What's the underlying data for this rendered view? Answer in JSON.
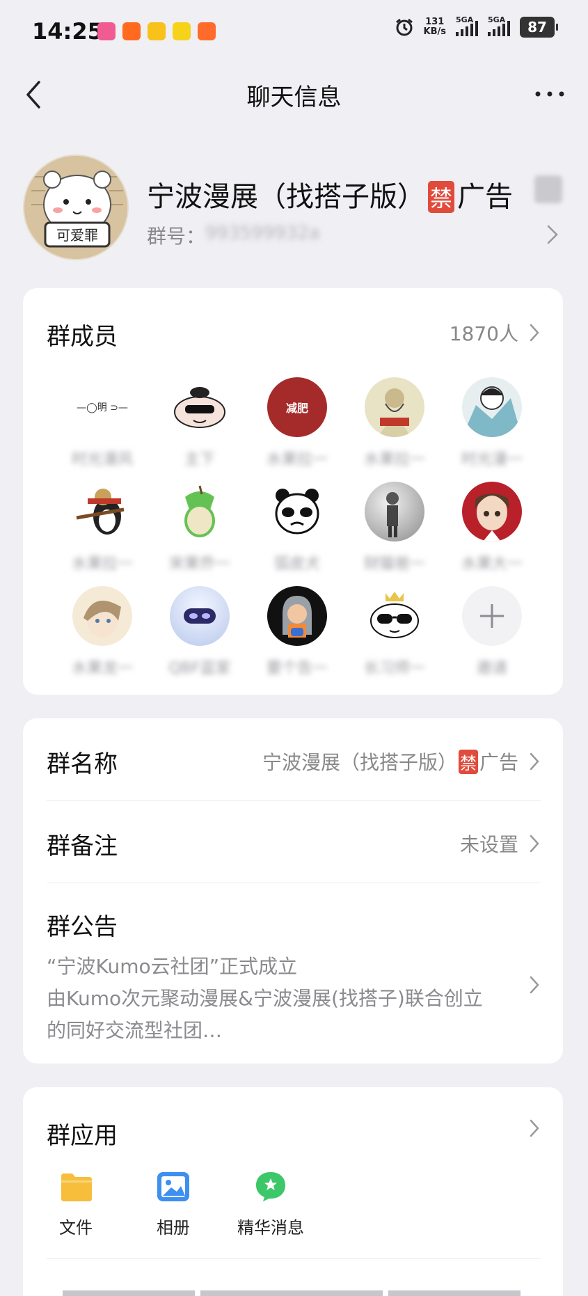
{
  "status_bar": {
    "time": "14:25",
    "net_speed": "131",
    "net_unit": "KB/s",
    "sim1": "5GA",
    "sim2": "5GA",
    "battery": "87"
  },
  "header": {
    "title": "聊天信息"
  },
  "group": {
    "name_part1": "宁波漫展（找搭子版）",
    "ban_char": "禁",
    "name_part2": "广告",
    "id_label": "群号：",
    "id_value": "993599932a"
  },
  "members": {
    "label": "群成员",
    "count": "1870人",
    "items": [
      {
        "name": "时光漫风"
      },
      {
        "name": "主下"
      },
      {
        "name": "水果拉一"
      },
      {
        "name": "水果拉一"
      },
      {
        "name": "时光漫一"
      },
      {
        "name": "水果拉一"
      },
      {
        "name": "宋果乔一"
      },
      {
        "name": "弧皮犬"
      },
      {
        "name": "财猫爸一"
      },
      {
        "name": "水果大一"
      },
      {
        "name": "水果龙一"
      },
      {
        "name": "QBF蓝家"
      },
      {
        "name": "要个告一"
      },
      {
        "name": "长习师一"
      },
      {
        "name": "邀请"
      }
    ]
  },
  "info": {
    "name_label": "群名称",
    "name_value_part1": "宁波漫展（找搭子版）",
    "name_value_ban": "禁",
    "name_value_part2": "广告",
    "remark_label": "群备注",
    "remark_value": "未设置",
    "notice_label": "群公告",
    "notice_line1": "“宁波Kumo云社团”正式成立",
    "notice_line2": "由Kumo次元聚动漫展&宁波漫展(找搭子)联合创立",
    "notice_line3": "的同好交流型社团…"
  },
  "apps": {
    "label": "群应用",
    "items": [
      {
        "label": "文件",
        "icon": "folder-icon"
      },
      {
        "label": "相册",
        "icon": "album-icon"
      },
      {
        "label": "精华消息",
        "icon": "featured-message-icon"
      }
    ]
  },
  "colors": {
    "background": "#efeff4",
    "ban_badge": "#e04b3c",
    "folder": "#f6be3b",
    "album": "#3d8ff0",
    "featured": "#3cc768"
  }
}
